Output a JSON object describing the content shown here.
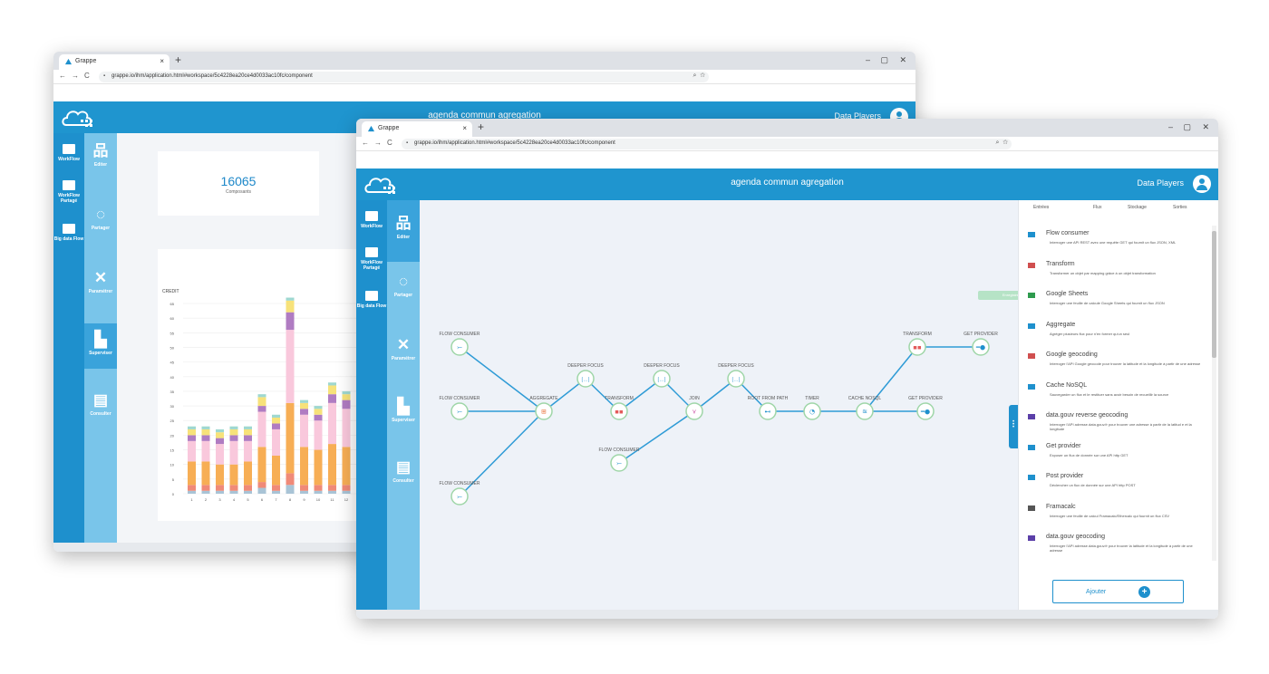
{
  "browser": {
    "tab_title": "Grappe",
    "tab_close": "×",
    "new_tab": "+",
    "url": "grappe.io/ihm/application.html#workspace/5c4228ea20ce4d0033ac10fc/component",
    "minimize": "–",
    "restore": "▢",
    "close": "✕",
    "back": "←",
    "forward": "→",
    "reload": "C",
    "lock": "🔒",
    "zoom_icon": "⌕",
    "star_icon": "☆"
  },
  "app": {
    "title": "agenda commun agregation",
    "user": "Data Players",
    "brand_color": "#1f95cf"
  },
  "sidebar_primary": [
    {
      "label": "WorkFlow",
      "icon": "folder-icon"
    },
    {
      "label": "WorkFlow Partagé",
      "icon": "shared-folder-icon"
    },
    {
      "label": "Big data Flow",
      "icon": "folder-icon"
    }
  ],
  "sidebar_secondary": [
    {
      "label": "Editer",
      "icon": "sitemap-icon"
    },
    {
      "label": "Partager",
      "icon": "share-icon"
    },
    {
      "label": "Paramétrer",
      "icon": "tools-icon"
    },
    {
      "label": "Superviser",
      "icon": "bar-chart-icon"
    },
    {
      "label": "Consulter",
      "icon": "inbox-icon"
    }
  ],
  "dashboard": {
    "count": "16065",
    "count_label": "Composants"
  },
  "chart_data": {
    "type": "bar",
    "stacked": true,
    "ylabel": "CREDIT",
    "yticks": [
      "0",
      "5",
      "10",
      "15",
      "20",
      "25",
      "30",
      "35",
      "40",
      "45",
      "50",
      "55",
      "60",
      "65"
    ],
    "ylim": [
      0,
      65
    ],
    "categories": [
      "1",
      "2",
      "3",
      "4",
      "5",
      "6",
      "7",
      "8",
      "9",
      "10",
      "11",
      "12",
      "13"
    ],
    "series": [
      {
        "color": "#a9c4d6",
        "values": [
          1,
          1,
          1,
          1,
          1,
          2,
          1,
          3,
          1,
          1,
          1,
          1,
          2
        ]
      },
      {
        "color": "#f08a78",
        "values": [
          2,
          2,
          2,
          2,
          2,
          2,
          2,
          4,
          2,
          2,
          2,
          2,
          2
        ]
      },
      {
        "color": "#f7ae55",
        "values": [
          8,
          8,
          7,
          7,
          8,
          12,
          10,
          24,
          13,
          12,
          14,
          13,
          14
        ]
      },
      {
        "color": "#f9c8dc",
        "values": [
          7,
          7,
          7,
          8,
          7,
          12,
          9,
          25,
          11,
          10,
          14,
          13,
          12
        ]
      },
      {
        "color": "#b07cc2",
        "values": [
          2,
          2,
          2,
          2,
          2,
          2,
          2,
          6,
          2,
          2,
          3,
          3,
          3
        ]
      },
      {
        "color": "#f7e27a",
        "values": [
          2,
          2,
          2,
          2,
          2,
          3,
          2,
          4,
          2,
          2,
          3,
          2,
          3
        ]
      },
      {
        "color": "#9fd8d0",
        "values": [
          1,
          1,
          1,
          1,
          1,
          1,
          1,
          1,
          1,
          1,
          1,
          1,
          1
        ]
      }
    ]
  },
  "flow": {
    "saved_label": "Enregistré",
    "nodes": [
      {
        "id": "fc1",
        "label": "FLOW CONSUMER",
        "kind": "consumer"
      },
      {
        "id": "fc2",
        "label": "FLOW CONSUMER",
        "kind": "consumer"
      },
      {
        "id": "fc3",
        "label": "FLOW CONSUMER",
        "kind": "consumer"
      },
      {
        "id": "agg",
        "label": "AGGREGATE",
        "kind": "aggregate"
      },
      {
        "id": "df1",
        "label": "DEEPER FOCUS",
        "kind": "focus"
      },
      {
        "id": "tr1",
        "label": "TRANSFORM",
        "kind": "transform"
      },
      {
        "id": "df2",
        "label": "DEEPER FOCUS",
        "kind": "focus"
      },
      {
        "id": "fc4",
        "label": "FLOW CONSUMER",
        "kind": "consumer"
      },
      {
        "id": "join",
        "label": "JOIN",
        "kind": "join"
      },
      {
        "id": "df3",
        "label": "DEEPER FOCUS",
        "kind": "focus"
      },
      {
        "id": "root",
        "label": "ROOT FROM PATH",
        "kind": "root"
      },
      {
        "id": "timer",
        "label": "TIMER",
        "kind": "timer"
      },
      {
        "id": "cache",
        "label": "CACHE NOSQL",
        "kind": "cache"
      },
      {
        "id": "getp1",
        "label": "GET PROVIDER",
        "kind": "provider"
      },
      {
        "id": "tr2",
        "label": "TRANSFORM",
        "kind": "transform"
      },
      {
        "id": "getp2",
        "label": "GET PROVIDER",
        "kind": "provider"
      }
    ]
  },
  "right_panel": {
    "tabs": [
      "Entrées",
      "Flux",
      "Stockage",
      "Sorties"
    ],
    "components": [
      {
        "name": "Flow consumer",
        "icon": "consumer-icon",
        "desc": "Interroger une API REST avec une requête GET qui fournit un flux JSON, XML"
      },
      {
        "name": "Transform",
        "icon": "transform-icon",
        "desc": "Transformer un objet par mapping grâce à un objet transformation"
      },
      {
        "name": "Google Sheets",
        "icon": "sheets-icon",
        "desc": "Interroger une feuille de calcule Google Sheets qui fournit un flux JSON"
      },
      {
        "name": "Aggregate",
        "icon": "aggregate-icon",
        "desc": "Agréger plusieurs flux pour n'en former qu'un seul"
      },
      {
        "name": "Google geocoding",
        "icon": "geocoding-icon",
        "desc": "Interroger l'API Google geocode pour trouver la latitude et la longitude à partir de une adresse"
      },
      {
        "name": "Cache NoSQL",
        "icon": "cache-icon",
        "desc": "Sauvegarder un flux et le restituer sans avoir besoin de recueillir la source"
      },
      {
        "name": "data.gouv reverse geocoding",
        "icon": "reverse-geocoding-icon",
        "desc": "Interroger l'API adresse.data.gouv.fr pour trouver une adresse à partir de la latitud e et la longitude"
      },
      {
        "name": "Get provider",
        "icon": "get-provider-icon",
        "desc": "Exposer un flux de donnée sur une API http GET"
      },
      {
        "name": "Post provider",
        "icon": "post-provider-icon",
        "desc": "Déclencher un flux de donnée sur une API http POST"
      },
      {
        "name": "Framacalc",
        "icon": "framacalc-icon",
        "desc": "Interroger une feuille de calcul Framacalc/Ethercalc qui fournit un flux CSV"
      },
      {
        "name": "data.gouv geocoding",
        "icon": "geocoding-icon",
        "desc": "Interroger l'API adresse.data.gouv.fr pour trouver la latitude et la longitude à partir de une adresse"
      }
    ],
    "add_button": "Ajouter",
    "add_icon": "+"
  }
}
